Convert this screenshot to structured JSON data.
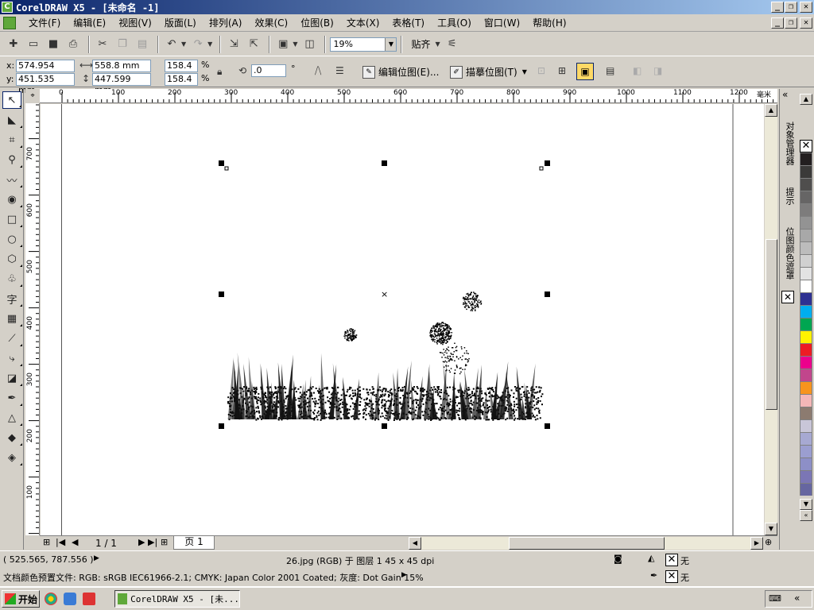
{
  "window": {
    "title": "CorelDRAW X5 - [未命名 -1]",
    "app_icon": "coreldraw-logo-icon"
  },
  "menu": [
    "文件(F)",
    "编辑(E)",
    "视图(V)",
    "版面(L)",
    "排列(A)",
    "效果(C)",
    "位图(B)",
    "文本(X)",
    "表格(T)",
    "工具(O)",
    "窗口(W)",
    "帮助(H)"
  ],
  "toolbar": {
    "zoom_value": "19%",
    "snap_label": "贴齐"
  },
  "property_bar": {
    "x_label": "x:",
    "x_value": "574.954 mm",
    "y_label": "y:",
    "y_value": "451.535 mm",
    "width_value": "558.8 mm",
    "height_value": "447.599 mm",
    "scale_x": "158.4",
    "scale_y": "158.4",
    "percent": "%",
    "rotation": ".0",
    "degree": "°",
    "edit_bitmap": "编辑位图(E)...",
    "trace_bitmap": "描摹位图(T)"
  },
  "ruler": {
    "unit": "毫米",
    "h_ticks": [
      "0",
      "100",
      "200",
      "300",
      "400",
      "500",
      "600",
      "700",
      "800",
      "900",
      "1000",
      "1100",
      "1200"
    ],
    "v_ticks": [
      "700",
      "600",
      "500",
      "400",
      "300",
      "200",
      "100"
    ]
  },
  "page_nav": {
    "page_count": "1 / 1",
    "tab_label": "页 1"
  },
  "dockers": {
    "object_manager": "对象管理器",
    "hints": "提示",
    "bitmap_mask": "位图颜色遮罩"
  },
  "palette": [
    "#231f20",
    "#3b3a39",
    "#4f4e4d",
    "#666565",
    "#7d7c7c",
    "#939393",
    "#a8a8a8",
    "#bcbcbc",
    "#d0d0d0",
    "#e3e3e3",
    "#ffffff",
    "#2e3192",
    "#00aeef",
    "#00a651",
    "#fff200",
    "#ed1c24",
    "#ec008c",
    "#c1468c",
    "#f7941d",
    "#f4b7b7",
    "#8c7b70",
    "#c9c6d8",
    "#a7a9d2",
    "#9b9ed0",
    "#8d8fc7",
    "#7b76b5",
    "#6666a0"
  ],
  "status": {
    "cursor_pos": "( 525.565, 787.556 )",
    "object_info": "26.jpg (RGB) 于 图层 1 45 x 45 dpi",
    "color_profile": "文档颜色预置文件: RGB: sRGB IEC61966-2.1; CMYK: Japan Color 2001 Coated; 灰度: Dot Gain 15%",
    "fill_none": "无",
    "outline_none": "无"
  },
  "taskbar": {
    "start_label": "开始",
    "task_label": "CorelDRAW X5 - [未..."
  }
}
